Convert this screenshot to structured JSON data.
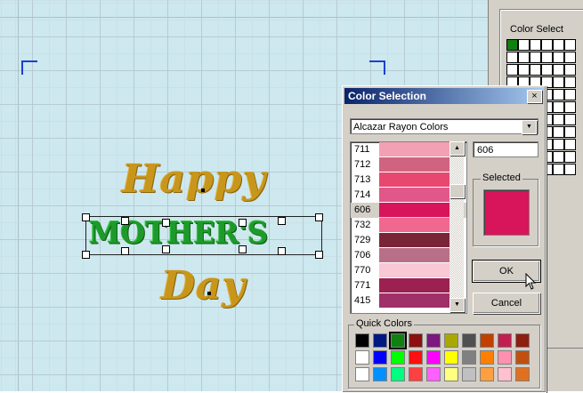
{
  "canvas": {
    "words": [
      "Happy",
      "MOTHER'S",
      "Day"
    ]
  },
  "side_panel": {
    "title": "Color Select"
  },
  "dialog": {
    "title": "Color Selection",
    "close_glyph": "×",
    "thread_set": "Alcazar Rayon Colors",
    "color_code": "606",
    "selected_label": "Selected",
    "selected_color": "#d8145a",
    "ok_label": "OK",
    "cancel_label": "Cancel",
    "quick_colors_label": "Quick Colors",
    "colors": [
      {
        "num": "711",
        "color": "#f4a0b4"
      },
      {
        "num": "712",
        "color": "#d06480"
      },
      {
        "num": "713",
        "color": "#e84870"
      },
      {
        "num": "714",
        "color": "#e05888"
      },
      {
        "num": "606",
        "color": "#d8145a"
      },
      {
        "num": "732",
        "color": "#f06890"
      },
      {
        "num": "729",
        "color": "#7a2438"
      },
      {
        "num": "706",
        "color": "#b87088"
      },
      {
        "num": "770",
        "color": "#f8c8d4"
      },
      {
        "num": "771",
        "color": "#9c2050"
      },
      {
        "num": "415",
        "color": "#a03068"
      }
    ],
    "quick_colors": [
      "#000000",
      "#001880",
      "#108010",
      "#8c1010",
      "#7c1880",
      "#a8a800",
      "#505050",
      "#c04000",
      "#c02050",
      "#8c2010",
      "#ffffff",
      "#0000ff",
      "#00ff00",
      "#ff1010",
      "#ff00ff",
      "#ffff00",
      "#808080",
      "#ff8000",
      "#ff90b0",
      "#c05010",
      "#ffffff",
      "#0090ff",
      "#00ff80",
      "#ff4040",
      "#ff60ff",
      "#ffff80",
      "#c0c0c0",
      "#ffa040",
      "#ffc0d0",
      "#e07020"
    ]
  }
}
